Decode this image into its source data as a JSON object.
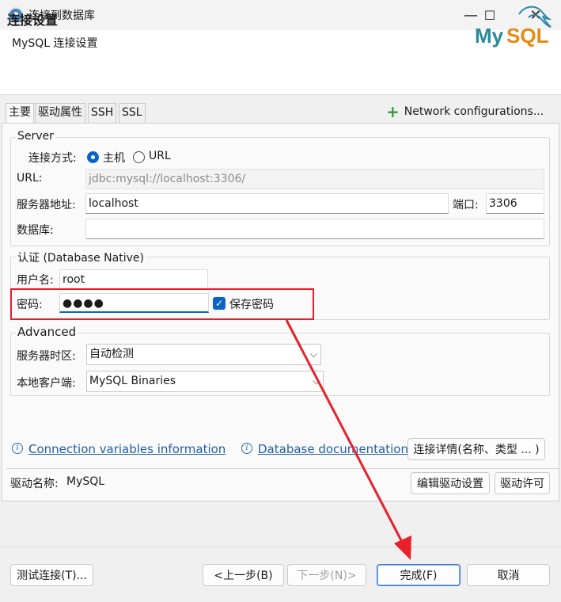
{
  "window": {
    "title": "连接到数据库",
    "minimize_icon": "—",
    "maximize_icon": "☐",
    "close_icon": "✕"
  },
  "header": {
    "title": "连接设置",
    "subtitle": "MySQL 连接设置",
    "logo_text": "MySQL"
  },
  "tabs": [
    {
      "label": "主要",
      "active": true
    },
    {
      "label": "驱动属性",
      "active": false
    },
    {
      "label": "SSH",
      "active": false
    },
    {
      "label": "SSL",
      "active": false
    }
  ],
  "network_config": {
    "icon": "+",
    "label": "Network configurations..."
  },
  "server": {
    "legend": "Server",
    "connect_mode_label": "连接方式:",
    "radio_host_label": "主机",
    "radio_url_label": "URL",
    "selected_mode": "主机",
    "url_label": "URL:",
    "url_value": "jdbc:mysql://localhost:3306/",
    "host_label": "服务器地址:",
    "host_value": "localhost",
    "port_label": "端口:",
    "port_value": "3306",
    "database_label": "数据库:",
    "database_value": ""
  },
  "auth": {
    "legend": "认证 (Database Native)",
    "username_label": "用户名:",
    "username_value": "root",
    "password_label": "密码:",
    "password_value": "●●●●",
    "save_password_label": "保存密码",
    "save_password_checked": true,
    "checkmark": "✓"
  },
  "advanced": {
    "legend": "Advanced",
    "timezone_label": "服务器时区:",
    "timezone_value": "自动检测",
    "client_label": "本地客户端:",
    "client_value": "MySQL Binaries",
    "chevron": "⌵"
  },
  "links": {
    "info_icon": "i",
    "conn_vars": "Connection variables information",
    "db_docs": "Database documentation",
    "details_button": "连接详情(名称、类型 ... )"
  },
  "driver": {
    "label": "驱动名称:",
    "value": "MySQL",
    "edit_button": "编辑驱动设置",
    "license_button": "驱动许可"
  },
  "footer": {
    "test_button": "测试连接(T)...",
    "back_button": "<上一步(B)",
    "next_button": "下一步(N)>",
    "finish_button": "完成(F)",
    "cancel_button": "取消"
  },
  "colors": {
    "highlight_box": "#e0202a",
    "accent": "#0a64c8",
    "link": "#1f5faa"
  }
}
